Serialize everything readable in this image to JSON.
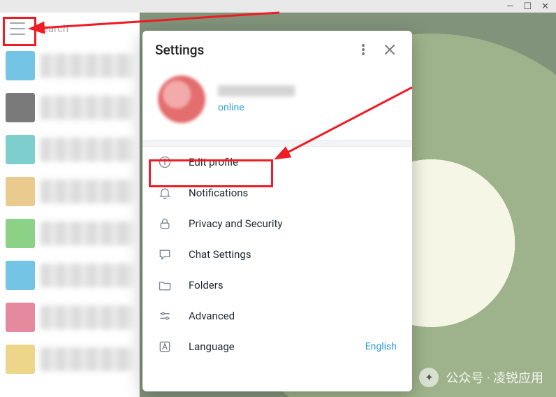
{
  "window": {
    "search_placeholder": "Search"
  },
  "content": {
    "banner": "messaging"
  },
  "settings": {
    "title": "Settings",
    "status": "online",
    "items": [
      {
        "key": "edit-profile",
        "label": "Edit profile",
        "icon": "info-icon"
      },
      {
        "key": "notifications",
        "label": "Notifications",
        "icon": "bell-icon"
      },
      {
        "key": "privacy-security",
        "label": "Privacy and Security",
        "icon": "lock-icon"
      },
      {
        "key": "chat-settings",
        "label": "Chat Settings",
        "icon": "chat-icon"
      },
      {
        "key": "folders",
        "label": "Folders",
        "icon": "folder-icon"
      },
      {
        "key": "advanced",
        "label": "Advanced",
        "icon": "sliders-icon"
      },
      {
        "key": "language",
        "label": "Language",
        "icon": "language-icon",
        "value": "English"
      }
    ]
  },
  "watermark": {
    "text": "公众号 · 凌锐应用"
  }
}
